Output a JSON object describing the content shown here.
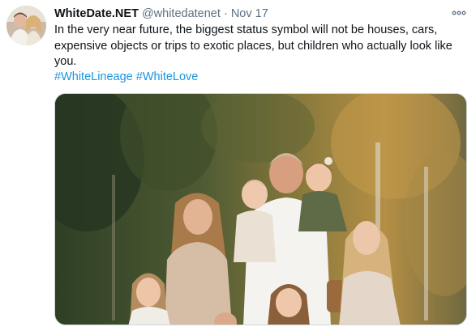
{
  "tweet": {
    "display_name": "WhiteDate.NET",
    "handle": "@whitedatenet",
    "separator": "·",
    "timestamp": "Nov 17",
    "more_icon": "more-horizontal-icon",
    "text": "In the very near future, the biggest status symbol will not be houses, cars, expensive objects or trips to exotic places, but children who actually look like you.",
    "hashtags": [
      "#WhiteLineage",
      "#WhiteLove"
    ]
  },
  "colors": {
    "text_primary": "#0f1419",
    "text_secondary": "#5b7083",
    "link": "#1b95e0",
    "media_border": "#cfd9de"
  }
}
